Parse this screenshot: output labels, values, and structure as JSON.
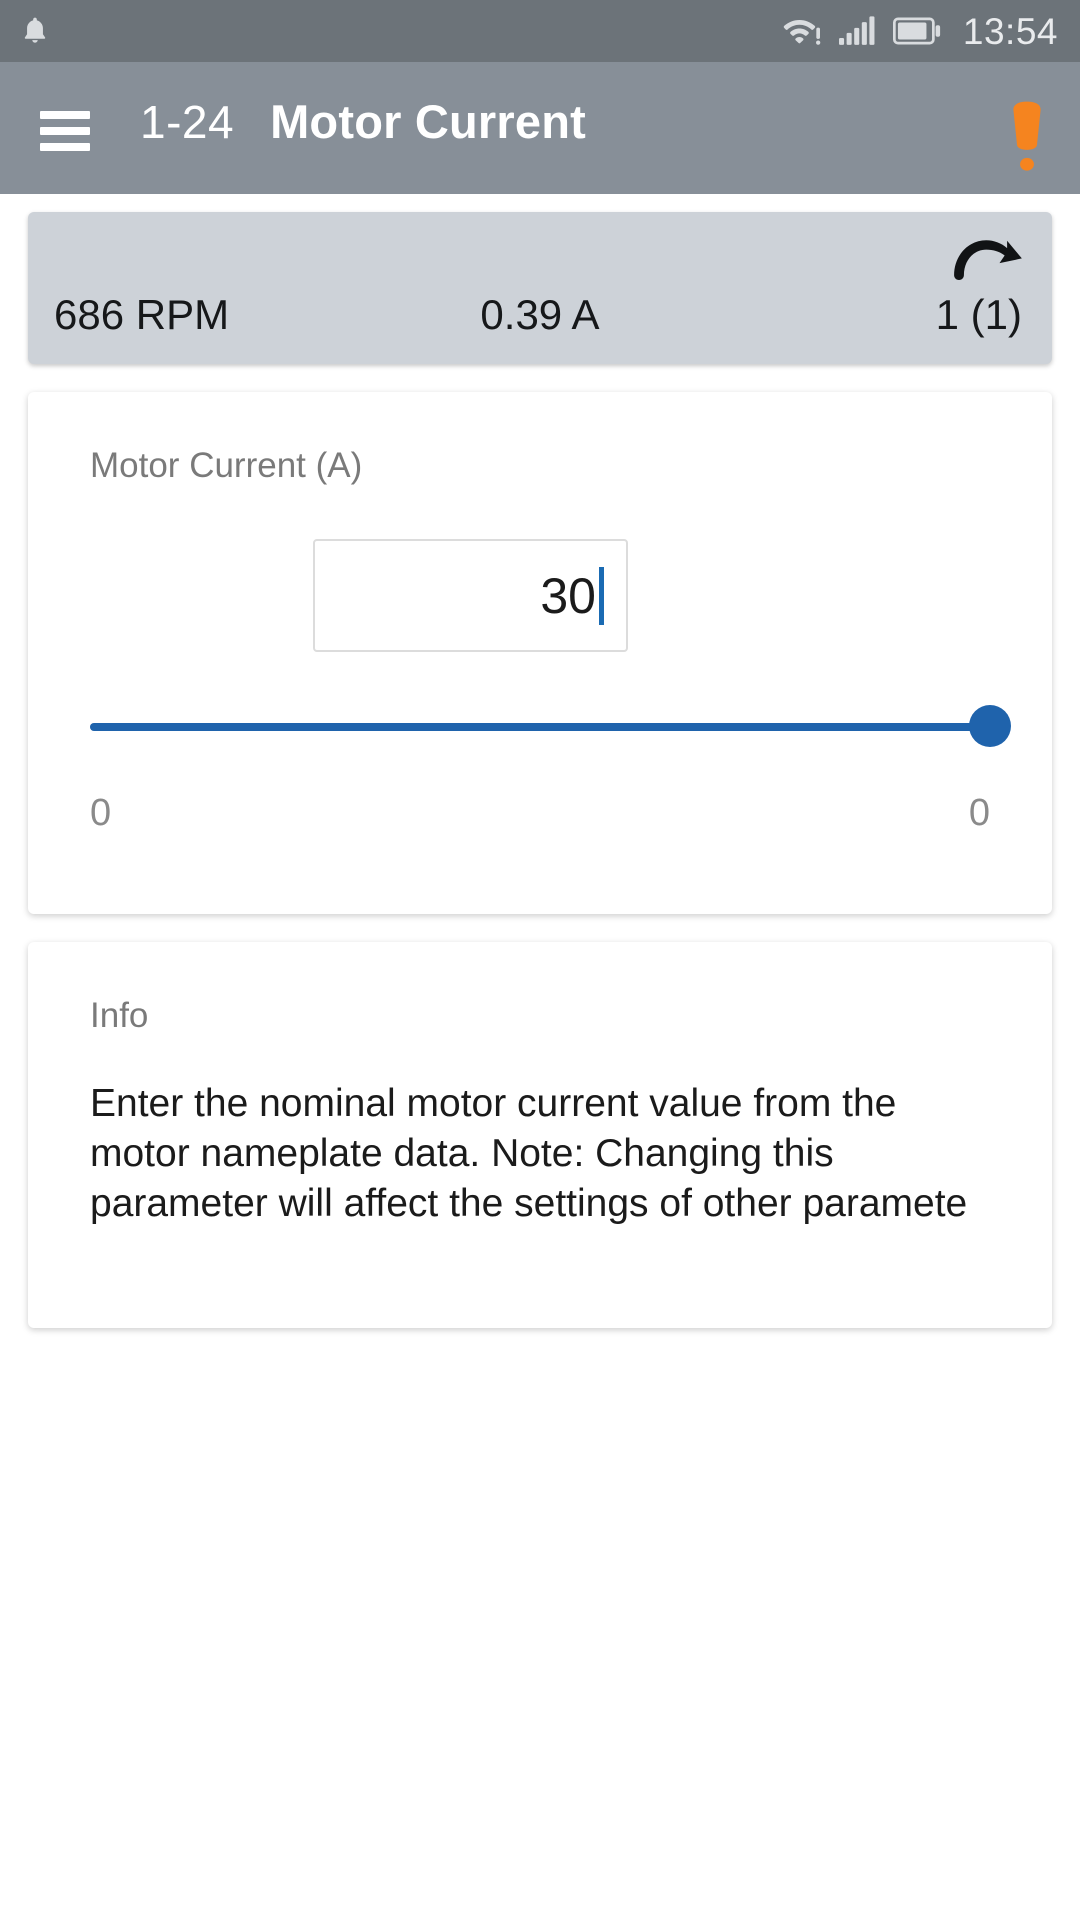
{
  "statusbar": {
    "notification_icon": "bell-icon",
    "wifi_icon": "wifi-warning-icon",
    "signal_icon": "cellular-signal-icon",
    "battery_icon": "battery-icon",
    "clock": "13:54"
  },
  "appbar": {
    "menu_icon": "hamburger-menu-icon",
    "parameter_id": "1-24",
    "title": "Motor Current",
    "alert_icon": "alert-exclamation-icon",
    "background_color": "#878f98"
  },
  "status_strip": {
    "speed": "686 RPM",
    "current": "0.39 A",
    "drive_state": "1 (1)",
    "rotation_icon": "rotate-clockwise-icon",
    "background_color": "#cdd2d8"
  },
  "parameter_card": {
    "label": "Motor Current (A)",
    "value": "30",
    "placeholder": "0",
    "slider": {
      "percent": 100,
      "min_label": "0",
      "max_label": "0",
      "accent_color": "#1f63ac"
    }
  },
  "info_card": {
    "label": "Info",
    "text": "Enter the nominal motor current value from the motor nameplate data. Note: Changing this parameter will affect the settings of other paramete"
  }
}
